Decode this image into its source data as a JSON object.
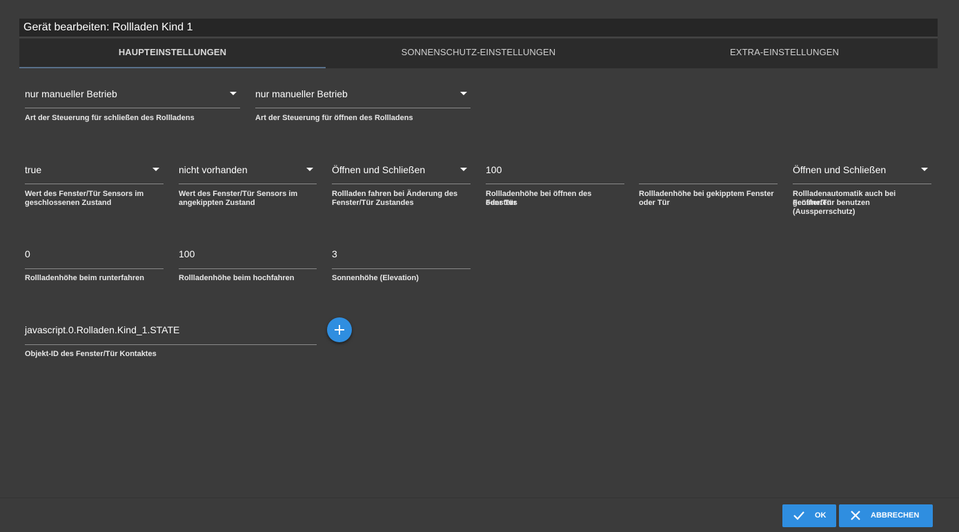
{
  "dialog": {
    "title": "Gerät bearbeiten: Rollladen Kind 1"
  },
  "tabs": [
    {
      "label": "HAUPTEINSTELLUNGEN",
      "active": true
    },
    {
      "label": "SONNENSCHUTZ-EINSTELLUNGEN",
      "active": false
    },
    {
      "label": "EXTRA-EINSTELLUNGEN",
      "active": false
    }
  ],
  "row1": {
    "close_control": {
      "value": "nur manueller Betrieb",
      "help": "Art der Steuerung für schließen des Rollladens"
    },
    "open_control": {
      "value": "nur manueller Betrieb",
      "help": "Art der Steuerung für öffnen des Rollladens"
    }
  },
  "row2": {
    "sensor_closed": {
      "value": "true",
      "help_line1": "Wert des Fenster/Tür Sensors im",
      "help_line2": "geschlossenen Zustand"
    },
    "sensor_tilted": {
      "value": "nicht vorhanden",
      "help_line1": "Wert des Fenster/Tür Sensors im",
      "help_line2": "angekippten Zustand"
    },
    "move_on_change": {
      "value": "Öffnen und Schließen",
      "help_line1": "Rollladen fahren bei Änderung des",
      "help_line2": "Fenster/Tür Zustandes"
    },
    "height_open_window": {
      "value": "100",
      "help_line1": "Rollladenhöhe bei öffnen des Fensters",
      "help_line2": "oder Tür"
    },
    "height_tilted_window": {
      "value": "",
      "help_line1": "Rollladenhöhe bei gekipptem Fenster",
      "help_line2": "oder Tür"
    },
    "lockout_protection": {
      "value": "Öffnen und Schließen",
      "help_line1": "Rollladenautomatik auch bei geöffneten",
      "help_line2": "Fenster/Tür benutzen (Aussperrschutz)"
    }
  },
  "row3": {
    "height_down": {
      "value": "0",
      "help": "Rollladenhöhe beim runterfahren"
    },
    "height_up": {
      "value": "100",
      "help": "Rollladenhöhe beim hochfahren"
    },
    "elevation": {
      "value": "3",
      "help": "Sonnenhöhe (Elevation)"
    }
  },
  "row4": {
    "object_id": {
      "value": "javascript.0.Rolladen.Kind_1.STATE",
      "help": "Objekt-ID des Fenster/Tür Kontaktes"
    }
  },
  "footer": {
    "ok_label": "OK",
    "cancel_label": "ABBRECHEN"
  },
  "colors": {
    "background": "#3b3b3b",
    "accent": "#2f8ee0",
    "tab_bar": "#2b2b2b"
  }
}
